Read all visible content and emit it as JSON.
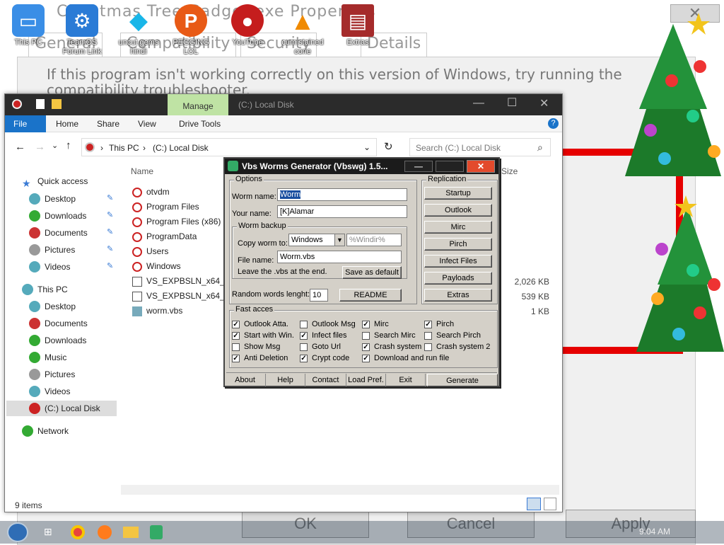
{
  "background_window": {
    "title": "Christmas Tree Gadget.exe Properties",
    "tabs": [
      "General",
      "Compatibility",
      "Security",
      "Details"
    ],
    "hint": "If this program isn't working correctly on this version of Windows, try running the compatibility troubleshooter.",
    "buttons": {
      "ok": "OK",
      "cancel": "Cancel",
      "apply": "Apply"
    },
    "close_glyph": "✕"
  },
  "desktop_icons": [
    {
      "label": "This PC",
      "icon": "computer-icon",
      "color": "#3a8ee6"
    },
    {
      "label": "TeamOS Forum Link",
      "icon": "gear-icon",
      "color": "#2a7bd6"
    },
    {
      "label": "uncut gems hindi",
      "icon": "diamond-icon",
      "color": "#19b6e8"
    },
    {
      "label": "PEGGING LOL",
      "icon": "p-logo-icon",
      "color": "#e85a16"
    },
    {
      "label": "YouTube",
      "icon": "angry-bird-icon",
      "color": "#c51d1d"
    },
    {
      "label": "cum stained cone",
      "icon": "vlc-cone-icon",
      "color": "#f08a00"
    },
    {
      "label": "Extras",
      "icon": "winrar-icon",
      "color": "#a52b2b"
    }
  ],
  "explorer": {
    "title": "(C:) Local Disk",
    "ribbon": {
      "manage": "Manage",
      "tabs": [
        "File",
        "Home",
        "Share",
        "View",
        "Drive Tools"
      ]
    },
    "breadcrumb": [
      "This PC",
      "(C:) Local Disk"
    ],
    "search_placeholder": "Search (C:) Local Disk",
    "columns": {
      "name": "Name",
      "size": "Size"
    },
    "sidebar": {
      "quick_access": "Quick access",
      "quick_items": [
        "Desktop",
        "Downloads",
        "Documents",
        "Pictures",
        "Videos"
      ],
      "this_pc": "This PC",
      "pc_items": [
        "Desktop",
        "Documents",
        "Downloads",
        "Music",
        "Pictures",
        "Videos",
        "(C:) Local Disk"
      ],
      "network": "Network"
    },
    "files": [
      {
        "name": "otvdm",
        "size": ""
      },
      {
        "name": "Program Files",
        "size": ""
      },
      {
        "name": "Program Files (x86)",
        "size": ""
      },
      {
        "name": "ProgramData",
        "size": ""
      },
      {
        "name": "Users",
        "size": ""
      },
      {
        "name": "Windows",
        "size": ""
      },
      {
        "name": "VS_EXPBSLN_x64_enu",
        "size": "2,026 KB"
      },
      {
        "name": "VS_EXPBSLN_x64_enu",
        "size": "539 KB"
      },
      {
        "name": "worm.vbs",
        "size": "1 KB"
      }
    ],
    "status": "9 items"
  },
  "vbs": {
    "title": "Vbs Worms Generator (Vbswg) 1.5...",
    "options_label": "Options",
    "worm_name_label": "Worm name:",
    "worm_name": "Worm",
    "your_name_label": "Your name:",
    "your_name": "[K]Alamar",
    "backup_label": "Worm backup",
    "copy_to_label": "Copy worm to:",
    "copy_to": "Windows",
    "copy_path": "%Windir%",
    "file_name_label": "File name:",
    "file_name": "Worm.vbs",
    "leave_vbs": "Leave the .vbs at the end.",
    "save_default": "Save as default",
    "random_label": "Random words lenght:",
    "random_value": "10",
    "readme": "README",
    "replication_label": "Replication",
    "replication": [
      "Startup",
      "Outlook",
      "Mirc",
      "Pirch",
      "Infect Files",
      "Payloads",
      "Extras"
    ],
    "fast_label": "Fast acces",
    "checks": [
      {
        "label": "Outlook Atta.",
        "checked": true
      },
      {
        "label": "Outlook Msg",
        "checked": false
      },
      {
        "label": "Mirc",
        "checked": true
      },
      {
        "label": "Pirch",
        "checked": true
      },
      {
        "label": "Start with Win.",
        "checked": true
      },
      {
        "label": "Infect files",
        "checked": true
      },
      {
        "label": "Search Mirc",
        "checked": false
      },
      {
        "label": "Search Pirch",
        "checked": false
      },
      {
        "label": "Show Msg",
        "checked": false
      },
      {
        "label": "Goto Url",
        "checked": false
      },
      {
        "label": "Crash system",
        "checked": true
      },
      {
        "label": "Crash system 2",
        "checked": false
      },
      {
        "label": "Anti Deletion",
        "checked": true
      },
      {
        "label": "Crypt code",
        "checked": true
      },
      {
        "label": "Download and run file",
        "checked": true
      }
    ],
    "bottom": [
      "About",
      "Help",
      "Contact",
      "Load Pref.",
      "Exit",
      "Generate"
    ]
  },
  "taskbar": {
    "clock": "9:04 AM"
  }
}
